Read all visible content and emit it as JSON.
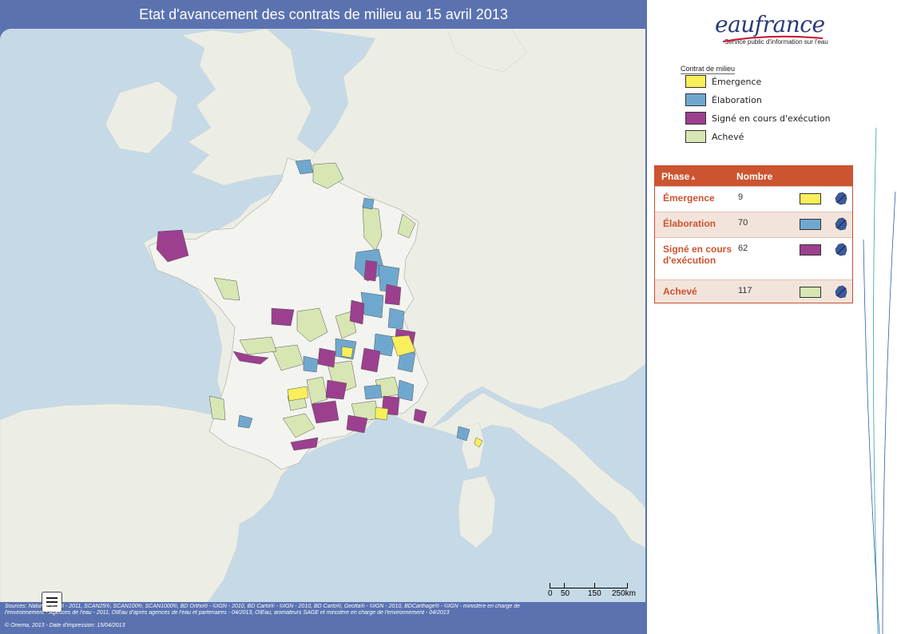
{
  "title": "Etat d'avancement des contrats de milieu au 15 avril 2013",
  "logo": {
    "name": "eaufrance",
    "tagline": "Service public d'information sur l'eau"
  },
  "legend": {
    "title": "Contrat de milieu",
    "items": [
      {
        "label": "Émergence",
        "color": "#f8ef5a"
      },
      {
        "label": "Élaboration",
        "color": "#6fa8cf"
      },
      {
        "label": "Signé en cours d'exécution",
        "color": "#9c3f8f"
      },
      {
        "label": "Achevé",
        "color": "#d8e6b4"
      }
    ]
  },
  "table": {
    "headers": {
      "phase": "Phase",
      "count": "Nombre"
    },
    "rows": [
      {
        "phase": "Émergence",
        "count": "9",
        "color": "#f8ef5a",
        "icon": "france-map-icon"
      },
      {
        "phase": "Élaboration",
        "count": "70",
        "color": "#6fa8cf",
        "icon": "france-map-icon"
      },
      {
        "phase": "Signé en cours d'exécution",
        "count": "62",
        "color": "#9c3f8f",
        "icon": "france-map-icon"
      },
      {
        "phase": "Achevé",
        "count": "117",
        "color": "#d8e6b4",
        "icon": "france-map-icon"
      }
    ]
  },
  "scale": {
    "labels": [
      "0",
      "50",
      "150",
      "250km"
    ]
  },
  "sources": {
    "line1": "Sources: NaturalEarth® - 2011, SCAN25®, SCAN100®, SCAN1000®, BD Ortho® - ©IGN - 2010, BD Carto® - ©IGN - 2010, BD Carto®, Geofla® - ©IGN - 2010, BDCarthage® - ©IGN - ministère en charge de",
    "line2": "l'environnement - Agences de l'eau - 2011, OIEau d'après agences de l'eau et partenaires - 04/2013, OIEau, animateurs SAGE et ministère en charge de l'environnement - 04/2013",
    "credit": "© Onema, 2013 - Date d'impression: 15/04/2013"
  },
  "colors": {
    "header_blue": "#5a72b0",
    "sea": "#c6d9e7",
    "land": "#eceee6",
    "france": "#f3f3f0",
    "table_accent": "#cc5430"
  }
}
